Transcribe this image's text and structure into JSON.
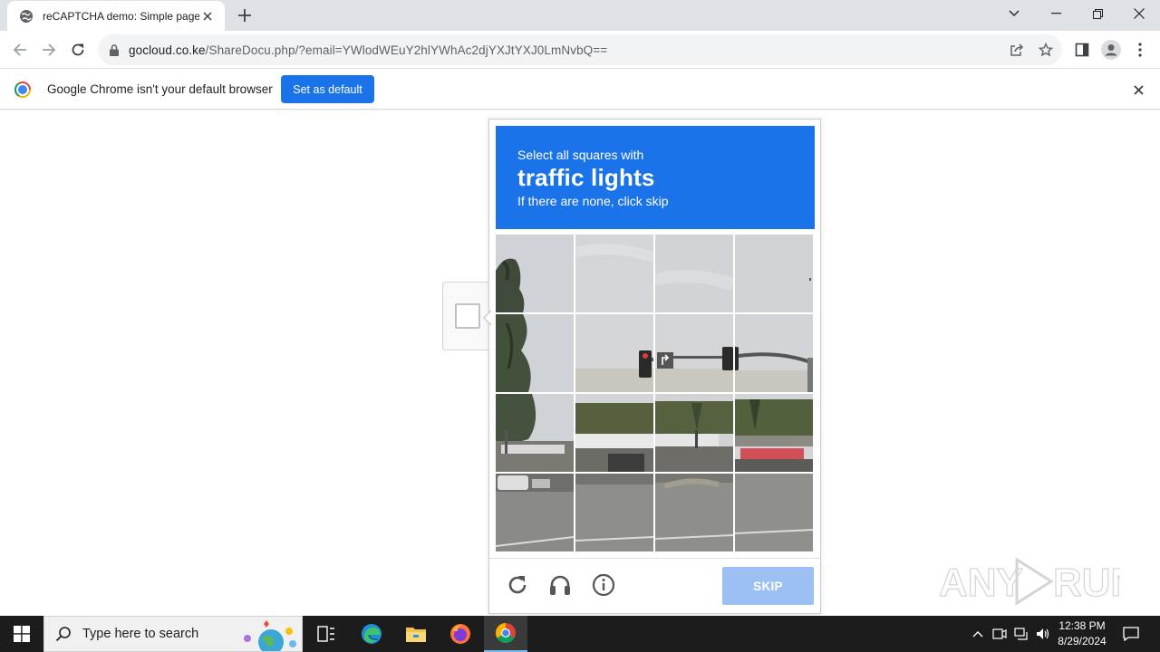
{
  "browser": {
    "tab": {
      "title": "reCAPTCHA demo: Simple page",
      "favicon": "globe-icon",
      "close_icon": "close-icon"
    },
    "new_tab_icon": "plus-icon",
    "window_controls": [
      "chevron-down-icon",
      "minimize-icon",
      "restore-icon",
      "close-icon"
    ],
    "address": {
      "host": "gocloud.co.ke",
      "path": "/ShareDocu.php/?email=YWlodWEuY2hlYWhAc2djYXJtYXJ0LmNvbQ=="
    },
    "toolbar_icons": [
      "back-icon",
      "forward-icon",
      "reload-icon",
      "lock-icon",
      "share-icon",
      "star-icon",
      "side-panel-icon",
      "profile-icon",
      "menu-icon"
    ]
  },
  "infobar": {
    "message": "Google Chrome isn't your default browser",
    "button_label": "Set as default"
  },
  "captcha": {
    "instruction_line1": "Select all squares with",
    "target": "traffic lights",
    "instruction_line3": "If there are none, click skip",
    "grid_rows": 4,
    "grid_cols": 4,
    "footer_icons": [
      "reload-icon",
      "headphones-icon",
      "info-icon"
    ],
    "skip_label": "SKIP",
    "accent_color": "#1a73e8",
    "skip_color": "#9cc0f3"
  },
  "watermark": {
    "text": "ANY RUN"
  },
  "taskbar": {
    "search_placeholder": "Type here to search",
    "apps": [
      "task-view-icon",
      "edge-icon",
      "file-explorer-icon",
      "firefox-icon",
      "chrome-icon"
    ],
    "time": "12:38 PM",
    "date": "8/29/2024"
  }
}
